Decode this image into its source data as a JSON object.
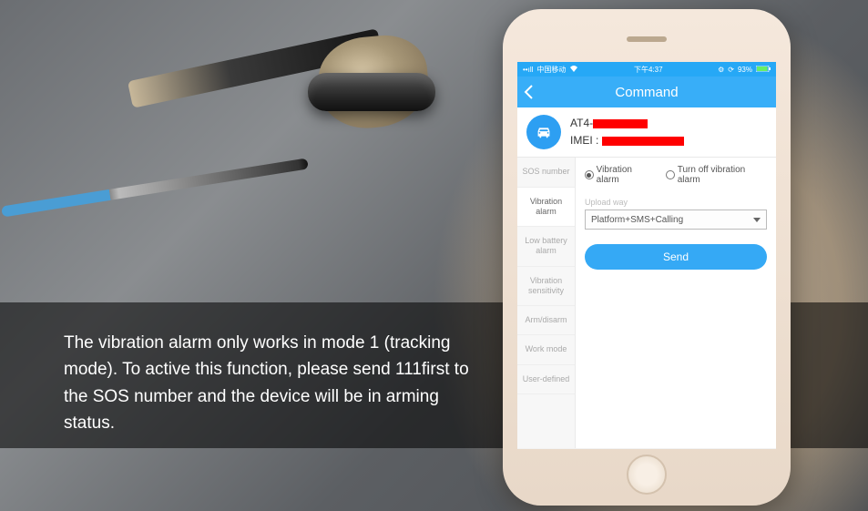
{
  "caption": "The vibration alarm only works in mode 1 (tracking mode). To active this function, please send 111first to the SOS number and the device will be in arming status.",
  "status": {
    "signal_label": "中国移动",
    "time": "下午4:37",
    "battery": "93%"
  },
  "nav": {
    "title": "Command"
  },
  "device": {
    "name_prefix": "AT4-",
    "imei_label": "IMEI :"
  },
  "sidebar": [
    "SOS number",
    "Vibration alarm",
    "Low battery alarm",
    "Vibration sensitivity",
    "Arm/disarm",
    "Work mode",
    "User-defined"
  ],
  "sidebar_active_index": 1,
  "content": {
    "radio_on": "Vibration alarm",
    "radio_off": "Turn off vibration alarm",
    "upload_label": "Upload way",
    "upload_value": "Platform+SMS+Calling",
    "send": "Send"
  }
}
